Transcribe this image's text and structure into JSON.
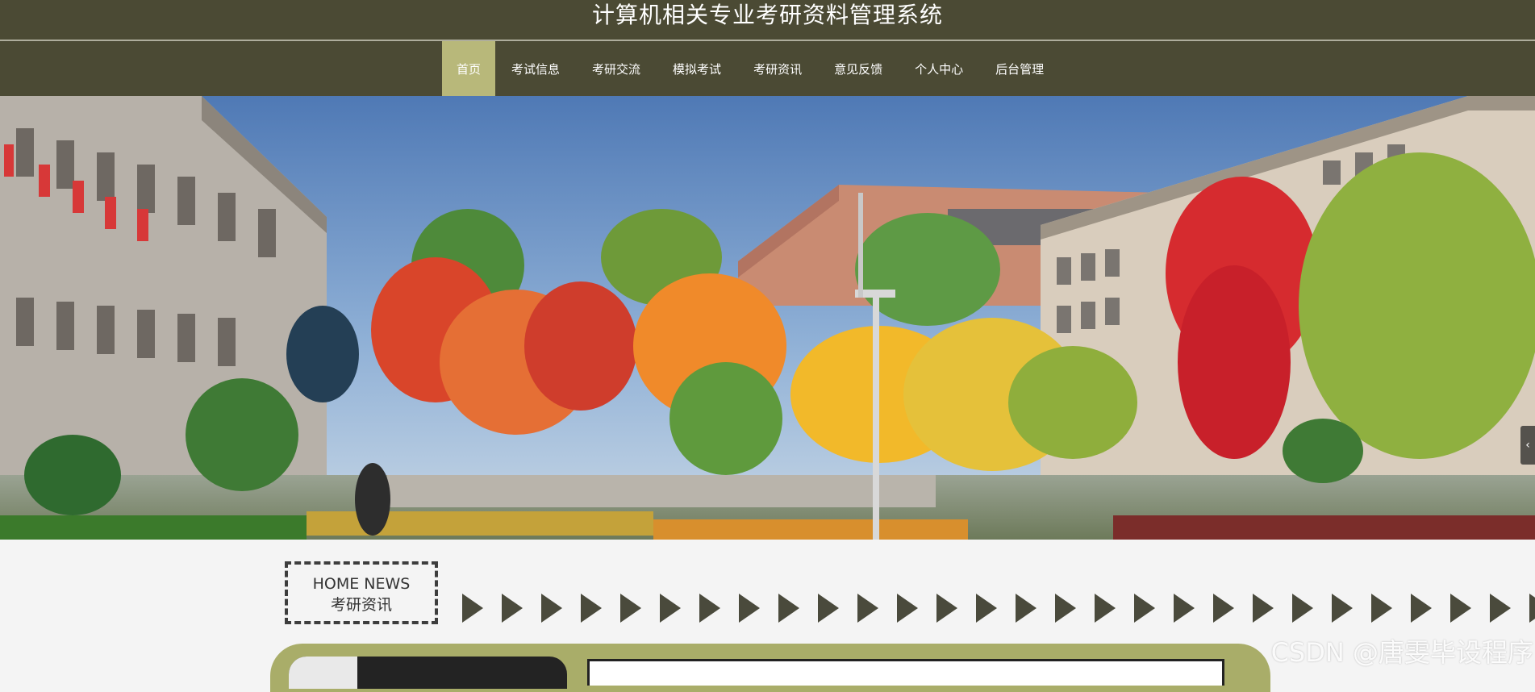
{
  "site": {
    "title": "计算机相关专业考研资料管理系统"
  },
  "nav": {
    "items": [
      {
        "label": "首页",
        "active": true
      },
      {
        "label": "考试信息",
        "active": false
      },
      {
        "label": "考研交流",
        "active": false
      },
      {
        "label": "模拟考试",
        "active": false
      },
      {
        "label": "考研资讯",
        "active": false
      },
      {
        "label": "意见反馈",
        "active": false
      },
      {
        "label": "个人中心",
        "active": false
      },
      {
        "label": "后台管理",
        "active": false
      }
    ]
  },
  "banner": {
    "image": "campus-autumn-scene",
    "next_icon": "chevron-left-icon",
    "next_glyph": "‹"
  },
  "news_section": {
    "label_en": "HOME NEWS",
    "label_cn": "考研资讯",
    "arrow_icon": "play-arrow-icon"
  },
  "watermark": {
    "text": "CSDN @唐雯毕设程序"
  },
  "colors": {
    "header_bg": "#4b4a34",
    "nav_active_bg": "#b8b87a",
    "panel_accent": "#a9ad69",
    "page_bg": "#f4f4f4"
  }
}
